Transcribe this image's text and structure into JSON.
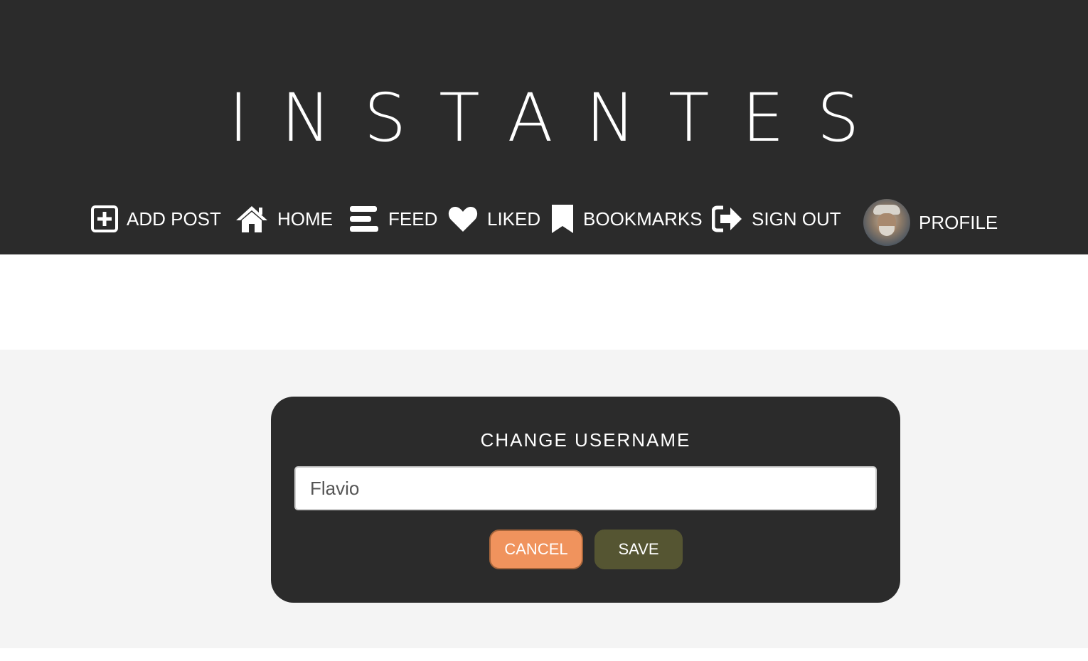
{
  "brand": {
    "logo_text": "INSTANTES"
  },
  "nav": {
    "add_post": {
      "label": "ADD POST",
      "icon": "plus-square-icon"
    },
    "home": {
      "label": "HOME",
      "icon": "home-icon"
    },
    "feed": {
      "label": "FEED",
      "icon": "feed-icon"
    },
    "liked": {
      "label": "LIKED",
      "icon": "heart-icon"
    },
    "bookmarks": {
      "label": "BOOKMARKS",
      "icon": "bookmark-icon"
    },
    "sign_out": {
      "label": "SIGN OUT",
      "icon": "sign-out-icon"
    },
    "profile": {
      "label": "PROFILE",
      "icon": "avatar"
    }
  },
  "change_username": {
    "title": "CHANGE USERNAME",
    "input_value": "Flavio",
    "cancel_label": "CANCEL",
    "save_label": "SAVE"
  },
  "colors": {
    "header_bg": "#2b2b2b",
    "page_bg": "#f4f4f4",
    "cancel_bg": "#f0935d",
    "save_bg": "#555532"
  }
}
